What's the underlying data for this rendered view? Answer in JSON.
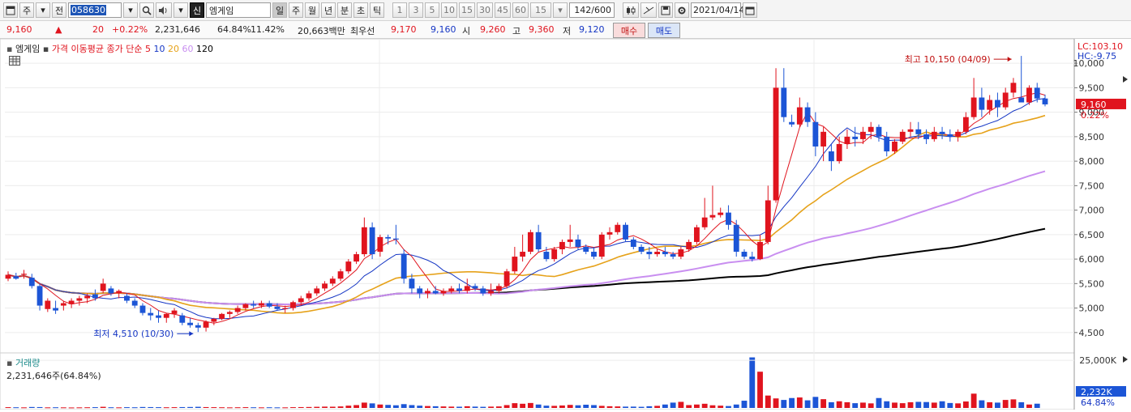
{
  "toolbar": {
    "market": "주",
    "prev": "전",
    "code": "058630",
    "stock_name": "엠게임",
    "period_tabs": [
      "일",
      "주",
      "월",
      "년",
      "분",
      "초",
      "틱"
    ],
    "active_period": "일",
    "intervals": [
      "1",
      "3",
      "5",
      "10",
      "15",
      "30",
      "45",
      "60"
    ],
    "interval_value": "15",
    "count": "142/600",
    "date": "2021/04/14"
  },
  "quote": {
    "price": "9,160",
    "arrow": "▲",
    "change": "20",
    "change_pct": "+0.22%",
    "volume": "2,231,646",
    "vol_ratio": "64.84%",
    "turnover": "11.42%",
    "amount": "20,663백만",
    "best_label": "최우선",
    "ask": "9,170",
    "bid": "9,160",
    "open_label": "시",
    "open": "9,260",
    "high_label": "고",
    "high": "9,360",
    "low_label": "저",
    "low": "9,120",
    "buy_button": "매수",
    "sell_button": "매도"
  },
  "legend": {
    "name": "엠게임",
    "title": "가격 이동평균",
    "type": "종가 단순",
    "periods": [
      "5",
      "10",
      "20",
      "60",
      "120"
    ],
    "colors": [
      "#e0141e",
      "#1536c4",
      "#e6a21a",
      "#c98ff0",
      "#000000"
    ]
  },
  "volume_legend": {
    "title": "거래량",
    "value": "2,231,646주(64.84%)"
  },
  "axis": {
    "top_label": "LC:103.10",
    "second_label": "HC:-9.75",
    "price_ticks": [
      "10,000",
      "9,500",
      "9,000",
      "8,500",
      "8,000",
      "7,500",
      "7,000",
      "6,500",
      "6,000",
      "5,500",
      "5,000",
      "4,500"
    ],
    "current_badge": "9,160",
    "current_pct": "0.22%",
    "vol_tick": "25,000K",
    "vol_badge": "2,232K",
    "vol_pct": "64.84%"
  },
  "annotations": {
    "high": "최고 10,150 (04/09)",
    "low": "최저 4,510 (10/30)"
  },
  "chart_data": {
    "type": "candlestick",
    "ylim": [
      4150,
      10300
    ],
    "price_ticks_values": [
      10000,
      9500,
      9000,
      8500,
      8000,
      7500,
      7000,
      6500,
      6000,
      5500,
      5000,
      4500
    ],
    "candles_ohlc": [
      [
        5600,
        5750,
        5550,
        5680
      ],
      [
        5650,
        5720,
        5580,
        5600
      ],
      [
        5680,
        5780,
        5600,
        5700
      ],
      [
        5620,
        5700,
        5400,
        5450
      ],
      [
        5450,
        5500,
        4950,
        5050
      ],
      [
        4980,
        5200,
        4920,
        5150
      ],
      [
        5000,
        5150,
        4880,
        4950
      ],
      [
        5050,
        5150,
        4950,
        5100
      ],
      [
        5080,
        5200,
        5000,
        5150
      ],
      [
        5150,
        5250,
        5050,
        5200
      ],
      [
        5200,
        5300,
        5100,
        5250
      ],
      [
        5280,
        5380,
        5150,
        5200
      ],
      [
        5350,
        5600,
        5300,
        5500
      ],
      [
        5400,
        5450,
        5250,
        5300
      ],
      [
        5300,
        5380,
        5200,
        5350
      ],
      [
        5250,
        5300,
        5100,
        5150
      ],
      [
        5150,
        5200,
        5000,
        5050
      ],
      [
        5050,
        5100,
        4850,
        4900
      ],
      [
        4900,
        5000,
        4750,
        4850
      ],
      [
        4850,
        4950,
        4700,
        4800
      ],
      [
        4800,
        4900,
        4700,
        4880
      ],
      [
        4880,
        5000,
        4800,
        4950
      ],
      [
        4850,
        4900,
        4650,
        4700
      ],
      [
        4700,
        4800,
        4600,
        4650
      ],
      [
        4650,
        4700,
        4510,
        4600
      ],
      [
        4600,
        4750,
        4520,
        4720
      ],
      [
        4720,
        4800,
        4650,
        4780
      ],
      [
        4780,
        4900,
        4750,
        4880
      ],
      [
        4880,
        4950,
        4800,
        4920
      ],
      [
        4920,
        5050,
        4880,
        5000
      ],
      [
        5000,
        5100,
        4950,
        5080
      ],
      [
        5080,
        5150,
        5000,
        5050
      ],
      [
        5050,
        5150,
        5000,
        5100
      ],
      [
        5100,
        5150,
        5000,
        5030
      ],
      [
        5030,
        5100,
        4950,
        4980
      ],
      [
        4980,
        5050,
        4900,
        5000
      ],
      [
        5000,
        5150,
        4950,
        5120
      ],
      [
        5120,
        5250,
        5050,
        5200
      ],
      [
        5200,
        5350,
        5150,
        5300
      ],
      [
        5300,
        5450,
        5250,
        5400
      ],
      [
        5400,
        5550,
        5350,
        5500
      ],
      [
        5500,
        5650,
        5450,
        5600
      ],
      [
        5600,
        5800,
        5550,
        5750
      ],
      [
        5750,
        6000,
        5700,
        5950
      ],
      [
        5950,
        6150,
        5900,
        6100
      ],
      [
        6100,
        6850,
        6050,
        6650
      ],
      [
        6650,
        6750,
        6000,
        6100
      ],
      [
        6150,
        6500,
        6050,
        6450
      ],
      [
        6450,
        6500,
        6300,
        6420
      ],
      [
        6420,
        6700,
        6300,
        6400
      ],
      [
        6100,
        6200,
        5500,
        5600
      ],
      [
        5600,
        5700,
        5300,
        5400
      ],
      [
        5400,
        5450,
        5200,
        5300
      ],
      [
        5300,
        5400,
        5200,
        5350
      ],
      [
        5350,
        5450,
        5280,
        5300
      ],
      [
        5300,
        5400,
        5250,
        5350
      ],
      [
        5350,
        5450,
        5300,
        5400
      ],
      [
        5400,
        5500,
        5300,
        5350
      ],
      [
        5350,
        5600,
        5300,
        5450
      ],
      [
        5450,
        5500,
        5350,
        5400
      ],
      [
        5400,
        5450,
        5250,
        5300
      ],
      [
        5300,
        5500,
        5250,
        5350
      ],
      [
        5350,
        5500,
        5300,
        5450
      ],
      [
        5450,
        5800,
        5400,
        5750
      ],
      [
        5750,
        6250,
        5700,
        6050
      ],
      [
        6050,
        6500,
        5950,
        6150
      ],
      [
        6150,
        6600,
        6100,
        6550
      ],
      [
        6550,
        6700,
        6150,
        6200
      ],
      [
        6150,
        6250,
        5950,
        6000
      ],
      [
        6000,
        6250,
        5950,
        6200
      ],
      [
        6200,
        6400,
        6100,
        6350
      ],
      [
        6350,
        6700,
        6250,
        6400
      ],
      [
        6400,
        6500,
        6200,
        6250
      ],
      [
        6250,
        6300,
        6100,
        6150
      ],
      [
        6150,
        6250,
        6000,
        6050
      ],
      [
        6050,
        6550,
        6000,
        6500
      ],
      [
        6500,
        6650,
        6400,
        6550
      ],
      [
        6550,
        6750,
        6500,
        6700
      ],
      [
        6700,
        6750,
        6350,
        6400
      ],
      [
        6400,
        6450,
        6200,
        6250
      ],
      [
        6250,
        6300,
        6100,
        6150
      ],
      [
        6150,
        6250,
        6000,
        6100
      ],
      [
        6100,
        6200,
        6050,
        6150
      ],
      [
        6150,
        6250,
        6050,
        6100
      ],
      [
        6100,
        6150,
        6000,
        6050
      ],
      [
        6050,
        6250,
        6000,
        6200
      ],
      [
        6200,
        6400,
        6150,
        6350
      ],
      [
        6350,
        6700,
        6300,
        6650
      ],
      [
        6650,
        7250,
        6600,
        6850
      ],
      [
        6850,
        7500,
        6800,
        6900
      ],
      [
        6900,
        7050,
        6850,
        6950
      ],
      [
        6950,
        7100,
        6600,
        6700
      ],
      [
        6700,
        6800,
        6050,
        6150
      ],
      [
        6150,
        6200,
        6000,
        6050
      ],
      [
        6050,
        6150,
        5950,
        6000
      ],
      [
        6000,
        6500,
        5980,
        6350
      ],
      [
        6350,
        7500,
        6300,
        7200
      ],
      [
        7200,
        9900,
        7150,
        9500
      ],
      [
        9500,
        9900,
        8800,
        8900
      ],
      [
        8800,
        8950,
        8700,
        8750
      ],
      [
        8750,
        9300,
        8700,
        9100
      ],
      [
        9100,
        9200,
        8700,
        8800
      ],
      [
        8800,
        9000,
        8100,
        8300
      ],
      [
        8300,
        8700,
        8000,
        8600
      ],
      [
        8200,
        8350,
        7800,
        8000
      ],
      [
        8000,
        8500,
        7950,
        8350
      ],
      [
        8350,
        8650,
        8250,
        8500
      ],
      [
        8500,
        8700,
        8300,
        8450
      ],
      [
        8450,
        8700,
        8350,
        8600
      ],
      [
        8600,
        8800,
        8450,
        8700
      ],
      [
        8700,
        8750,
        8400,
        8500
      ],
      [
        8500,
        8600,
        8100,
        8200
      ],
      [
        8200,
        8450,
        8150,
        8400
      ],
      [
        8400,
        8650,
        8350,
        8600
      ],
      [
        8600,
        8800,
        8500,
        8650
      ],
      [
        8650,
        8800,
        8450,
        8550
      ],
      [
        8550,
        8650,
        8350,
        8450
      ],
      [
        8450,
        8700,
        8400,
        8600
      ],
      [
        8600,
        8700,
        8450,
        8550
      ],
      [
        8550,
        8650,
        8400,
        8500
      ],
      [
        8500,
        8650,
        8400,
        8600
      ],
      [
        8600,
        9000,
        8550,
        8900
      ],
      [
        8900,
        9700,
        8850,
        9300
      ],
      [
        9300,
        9500,
        8900,
        9050
      ],
      [
        9050,
        9350,
        8950,
        9250
      ],
      [
        9250,
        9400,
        8900,
        9100
      ],
      [
        9100,
        9500,
        9050,
        9400
      ],
      [
        9400,
        9700,
        9300,
        9600
      ],
      [
        9300,
        10150,
        9250,
        9200
      ],
      [
        9200,
        9550,
        9150,
        9500
      ],
      [
        9500,
        9600,
        9200,
        9280
      ],
      [
        9280,
        9360,
        9120,
        9160
      ]
    ],
    "volume_k": [
      400,
      350,
      300,
      500,
      450,
      300,
      350,
      300,
      250,
      300,
      350,
      400,
      600,
      350,
      300,
      400,
      350,
      500,
      450,
      400,
      350,
      400,
      450,
      500,
      600,
      450,
      400,
      350,
      300,
      350,
      400,
      350,
      300,
      350,
      300,
      300,
      400,
      450,
      500,
      600,
      700,
      650,
      800,
      1200,
      1500,
      2800,
      2400,
      1800,
      1600,
      1400,
      2000,
      1500,
      1200,
      1000,
      900,
      800,
      700,
      650,
      900,
      700,
      600,
      700,
      800,
      1500,
      2500,
      2200,
      2600,
      1800,
      1200,
      1100,
      1300,
      1600,
      1400,
      1700,
      1500,
      1100,
      900,
      800,
      700,
      700,
      600,
      900,
      1100,
      1800,
      2800,
      3200,
      1500,
      1800,
      2200,
      1400,
      1200,
      1000,
      1800,
      3800,
      26500,
      19000,
      6500,
      5000,
      4200,
      5200,
      5500,
      4000,
      5800,
      4600,
      3000,
      3500,
      3000,
      2500,
      2800,
      2400,
      5200,
      3500,
      2800,
      2500,
      3000,
      3200,
      3100,
      2800,
      3500,
      2600,
      2400,
      3400,
      7500,
      4000,
      3000,
      2800,
      4200,
      4500,
      3000,
      1800,
      2232
    ]
  }
}
